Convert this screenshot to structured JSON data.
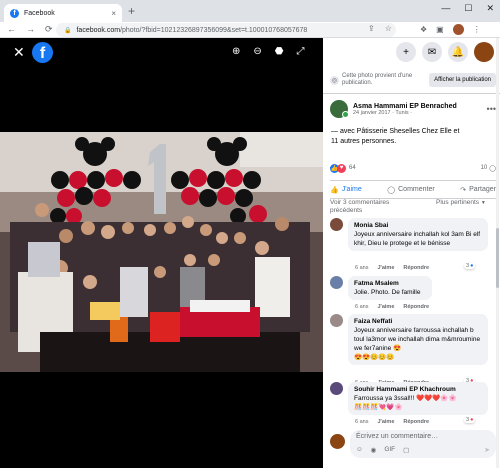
{
  "browser": {
    "tab_title": "Facebook",
    "tab_favicon": "f",
    "tab_close": "×",
    "new_tab": "+",
    "window_controls": [
      "—",
      "☐",
      "✕"
    ],
    "nav": [
      "←",
      "→",
      "⟳"
    ],
    "url_domain": "facebook.com",
    "url_path": "/photo/?fbid=10212326897356099&set=t.100010768057678",
    "lock_icon": "🔒",
    "address_icons": [
      "⇪",
      "☆"
    ],
    "toolbar_icons": [
      "❖",
      "▣",
      "⋮"
    ]
  },
  "viewer": {
    "close": "✕",
    "logo": "f",
    "tools": [
      "⊕",
      "⊖",
      "⬣",
      "⤢"
    ]
  },
  "panel": {
    "top_icons": [
      "+",
      "✉",
      "🔔"
    ],
    "public_notice": "Cette photo provient d'une publication.",
    "public_button": "Afficher la publication",
    "author_name": "Asma Hammami EP Benrached",
    "author_date": "24 janvier 2017 · Tunis · ",
    "more": "•••",
    "caption_line1": "— avec Pâtisserie Sheselles Chez Elle et",
    "caption_line2": "11 autres personnes.",
    "reaction_like": "👍",
    "reaction_heart": "♥",
    "reaction_count": "64",
    "comment_count": "10",
    "comment_icon": "◯",
    "actions": [
      {
        "icon": "👍",
        "label": "J'aime"
      },
      {
        "icon": "◯",
        "label": "Commenter"
      },
      {
        "icon": "↷",
        "label": "Partager"
      }
    ],
    "previous": "Voir 3 commentaires précédents",
    "relevant": "Plus pertinents",
    "relevant_chevron": "▼"
  },
  "comments": [
    {
      "name": "Monia Sbai",
      "text": "Joyeux anniversaire inchallah kol 3am Bi elf khir, Dieu le protege et le bénisse",
      "time": "6 ans",
      "like": "J'aime",
      "reply": "Répondre",
      "count": "3",
      "avatar_color": "#7a4b3a"
    },
    {
      "name": "Fatma Msalem",
      "text": "Jolie. Photo. De famille",
      "time": "6 ans",
      "like": "J'aime",
      "reply": "Répondre",
      "count": "",
      "avatar_color": "#6a7fa8"
    },
    {
      "name": "Faiza Neffati",
      "text": "Joyeux anniversaire farroussa inchallah b toul la3mor we inchallah dima m&mroumine we fer7anine 😍",
      "emojis": "😍😍😊😊😊",
      "time": "6 ans",
      "like": "J'aime",
      "reply": "Répondre",
      "count": "3",
      "avatar_color": "#9a8a8a"
    },
    {
      "name": "Souhir Hammami EP Khachroum",
      "text": "Farroussa ya 3ssal!!! ❤️❤️❤️🌸🌸",
      "emojis": "🎊🎊🎊💘💗🌸",
      "time": "6 ans",
      "like": "J'aime",
      "reply": "Répondre",
      "count": "3",
      "avatar_color": "#5a4a7a"
    }
  ],
  "composer": {
    "placeholder": "Écrivez un commentaire…",
    "icons": [
      "☺",
      "◉",
      "GIF",
      "▢"
    ],
    "send": "➤"
  }
}
